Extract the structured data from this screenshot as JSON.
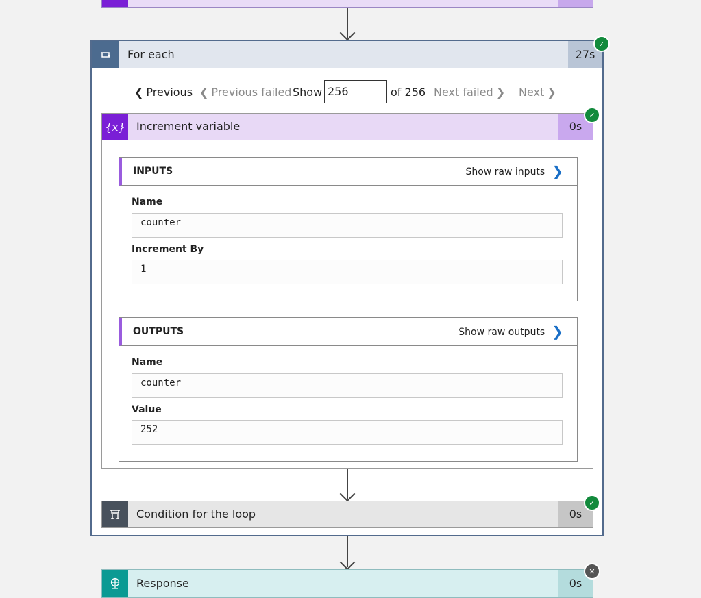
{
  "foreach": {
    "title": "For each",
    "icon": "loop-icon",
    "duration": "27s",
    "status": "succeeded"
  },
  "pager": {
    "previous_label": "Previous",
    "previous_failed_label": "Previous failed",
    "show_label": "Show",
    "current_page": "256",
    "of_label": "of 256",
    "next_failed_label": "Next failed",
    "next_label": "Next"
  },
  "increment_variable": {
    "title": "Increment variable",
    "icon_text": "{x}",
    "duration": "0s",
    "status": "succeeded",
    "inputs": {
      "title": "INPUTS",
      "raw_link": "Show raw inputs",
      "fields": [
        {
          "label": "Name",
          "value": "counter"
        },
        {
          "label": "Increment By",
          "value": "1"
        }
      ]
    },
    "outputs": {
      "title": "OUTPUTS",
      "raw_link": "Show raw outputs",
      "fields": [
        {
          "label": "Name",
          "value": "counter"
        },
        {
          "label": "Value",
          "value": "252"
        }
      ]
    }
  },
  "condition": {
    "title": "Condition for the loop",
    "duration": "0s",
    "status": "succeeded"
  },
  "response": {
    "title": "Response",
    "duration": "0s",
    "status": "failed"
  },
  "colors": {
    "loop_blue": "#4c6b8f",
    "variable_purple": "#7a1fd6",
    "condition_gray": "#48515c",
    "response_teal": "#0b9a93",
    "success_green": "#128a3c",
    "link_blue": "#1a6fc7"
  }
}
